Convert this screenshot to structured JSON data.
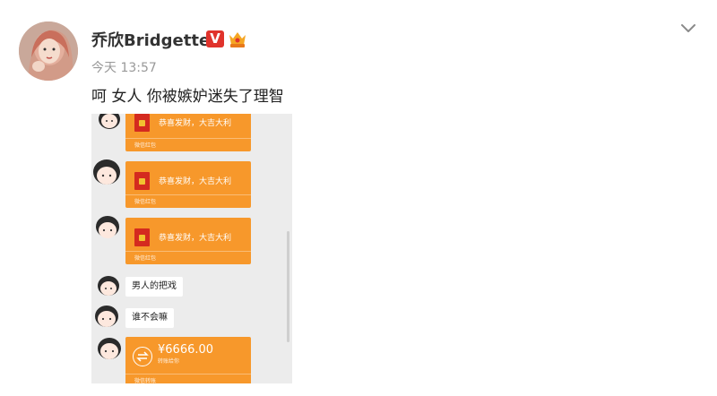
{
  "post": {
    "username": "乔欣Bridgette",
    "verified_badge": "V",
    "timestamp": "今天 13:57",
    "text": "呵 女人 你被嫉妒迷失了理智"
  },
  "icons": {
    "avatar": "avatar-photo",
    "verified": "verified-v-icon",
    "member": "member-crown-icon",
    "menu": "chevron-down-icon"
  },
  "chat": {
    "messages": [
      {
        "type": "red_packet",
        "text": "恭喜发财，大吉大利",
        "label": "微信红包"
      },
      {
        "type": "red_packet",
        "text": "恭喜发财，大吉大利",
        "label": "微信红包"
      },
      {
        "type": "red_packet",
        "text": "恭喜发财，大吉大利",
        "label": "微信红包"
      },
      {
        "type": "text",
        "text": "男人的把戏"
      },
      {
        "type": "text",
        "text": "谁不会嘛"
      },
      {
        "type": "transfer",
        "amount": "¥6666.00",
        "sub": "转账给你",
        "label": "微信转账"
      }
    ]
  },
  "colors": {
    "packet_orange": "#f7982b",
    "verified_red": "#e0332c",
    "chat_bg": "#ececec"
  }
}
